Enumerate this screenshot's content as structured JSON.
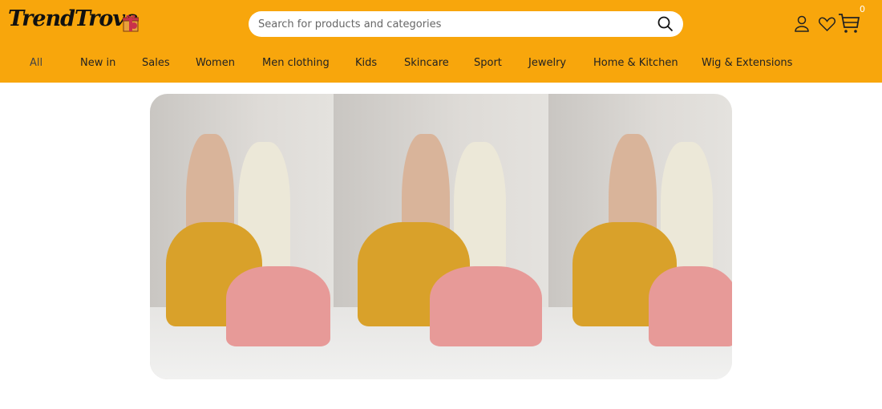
{
  "brand": {
    "name": "TrendTrove",
    "accent": "#F8A60C"
  },
  "search": {
    "placeholder": "Search for products and categories"
  },
  "header_icons": [
    "user-icon",
    "heart-icon",
    "cart-icon"
  ],
  "cart": {
    "count": "0"
  },
  "nav": [
    "All",
    "New in",
    "Sales",
    "Women",
    "Men clothing",
    "Kids",
    "Skincare",
    "Sport",
    "Jewelry",
    "Home & Kitchen",
    "Wig & Extensions"
  ]
}
